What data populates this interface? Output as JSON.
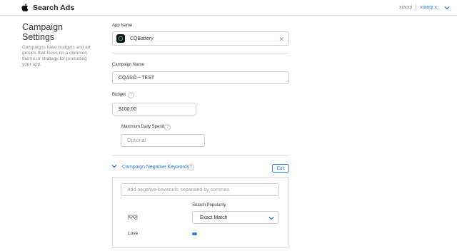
{
  "header": {
    "brand": "Search Ads",
    "account_name": "xiaoqi",
    "account_menu": "xiaoqi x.",
    "accent_color": "#2c7be5"
  },
  "sidebar": {
    "title": "Campaign Settings",
    "description": "Campaigns have budgets and ad groups that focus on a common theme or strategy for promoting your app."
  },
  "form": {
    "app_name_label": "App Name",
    "app_name_value": "CQBattery",
    "campaign_name_label": "Campaign Name",
    "campaign_name_value": "CQASO－TEST",
    "budget_label": "Budget",
    "budget_value": "$100.00",
    "max_daily_label": "Maximum Daily Spend",
    "max_daily_placeholder": "Optional",
    "help_glyph": "?"
  },
  "negative_keywords": {
    "title": "Campaign Negative Keywords",
    "edit_label": "Edit",
    "input_placeholder": "Add negative keywords separated by commas",
    "popularity_header": "Search Popularity",
    "rows": [
      {
        "keyword": "[QQ]",
        "match": "Exact Match"
      },
      {
        "keyword": "Love"
      }
    ]
  }
}
